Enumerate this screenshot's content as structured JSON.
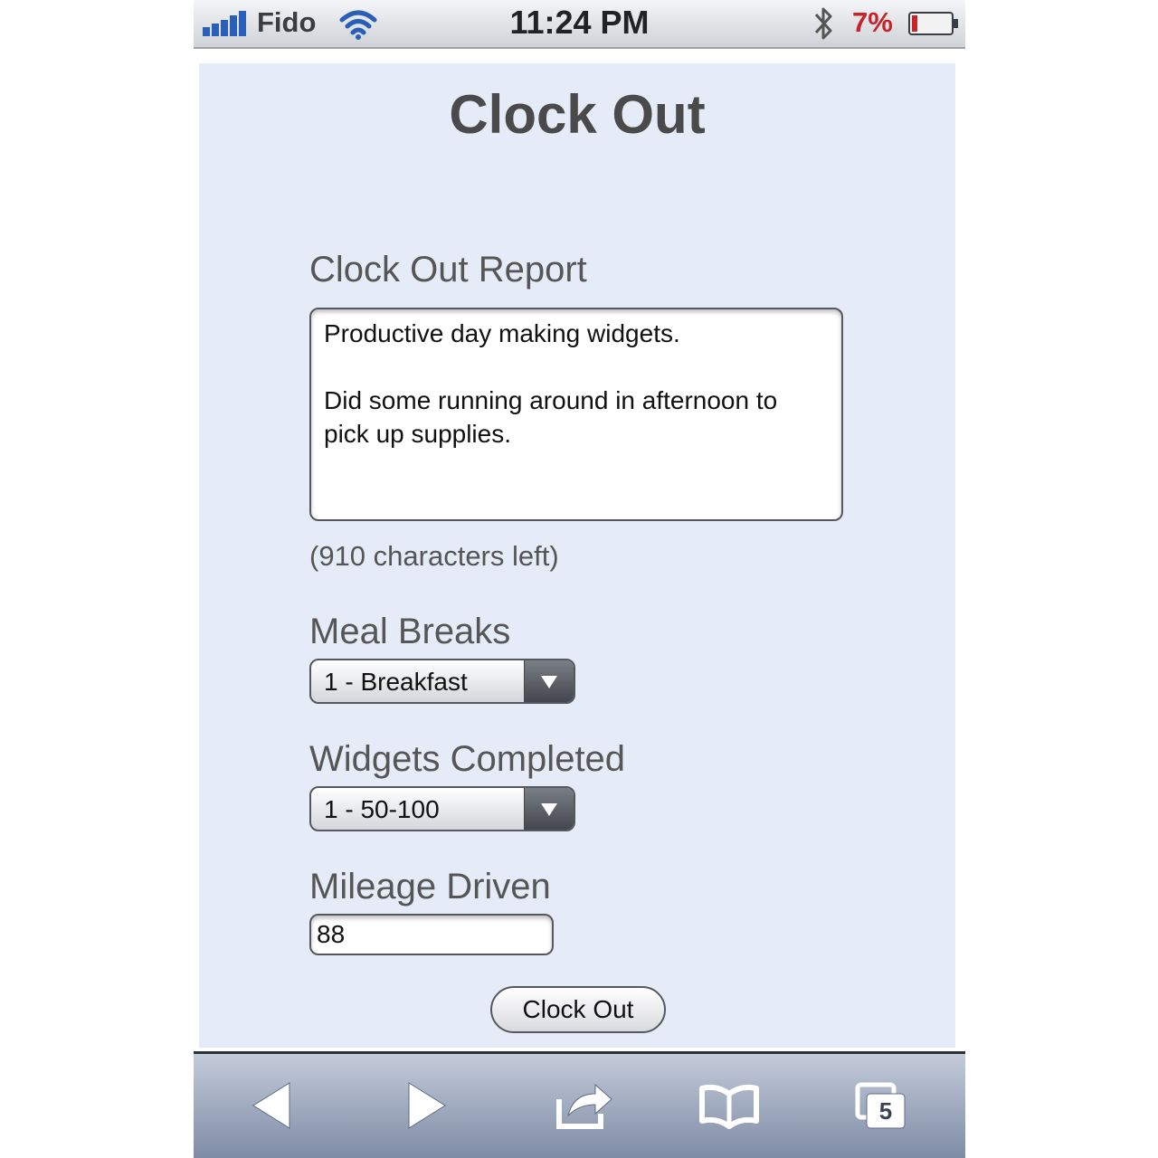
{
  "status_bar": {
    "carrier": "Fido",
    "time": "11:24 PM",
    "battery_percent": "7%",
    "icons": [
      "signal-bars-icon",
      "wifi-icon",
      "bluetooth-icon",
      "battery-icon"
    ]
  },
  "page": {
    "title": "Clock Out"
  },
  "form": {
    "report": {
      "label": "Clock Out Report",
      "value": "Productive day making widgets.\n\nDid some running around in afternoon to pick up supplies.",
      "chars_left": "(910 characters left)"
    },
    "meal_breaks": {
      "label": "Meal Breaks",
      "selected": "1 - Breakfast"
    },
    "widgets_completed": {
      "label": "Widgets Completed",
      "selected": "1 - 50-100"
    },
    "mileage": {
      "label": "Mileage Driven",
      "value": "88"
    },
    "submit_label": "Clock Out"
  },
  "toolbar": {
    "tabs_count": "5",
    "icons": [
      "back-arrow-icon",
      "forward-arrow-icon",
      "share-icon",
      "bookmarks-icon",
      "tabs-icon"
    ]
  },
  "colors": {
    "background": "#e5ebf7",
    "battery_low": "#c8232b",
    "toolbar_top": "#c3cbd9",
    "toolbar_bottom": "#7d8aa4"
  }
}
